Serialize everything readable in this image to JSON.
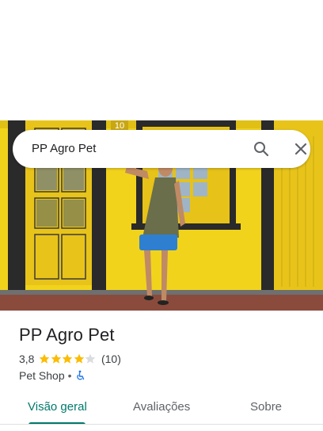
{
  "search": {
    "query": "PP Agro Pet"
  },
  "place": {
    "name": "PP Agro Pet",
    "rating": "3,8",
    "rating_value": 3.8,
    "stars_filled": 4,
    "stars_total": 5,
    "review_count": "(10)",
    "category": "Pet Shop",
    "separator": "•",
    "accessibility_icon": "wheelchair-icon"
  },
  "photo": {
    "sign_text": "10"
  },
  "tabs": [
    {
      "label": "Visão geral",
      "active": true
    },
    {
      "label": "Avaliações",
      "active": false
    },
    {
      "label": "Sobre",
      "active": false
    }
  ],
  "colors": {
    "accent": "#00796b",
    "star": "#fbbc04",
    "star_empty": "#dadce0",
    "wall_yellow": "#f2d31c",
    "accessible_blue": "#1a73e8"
  }
}
